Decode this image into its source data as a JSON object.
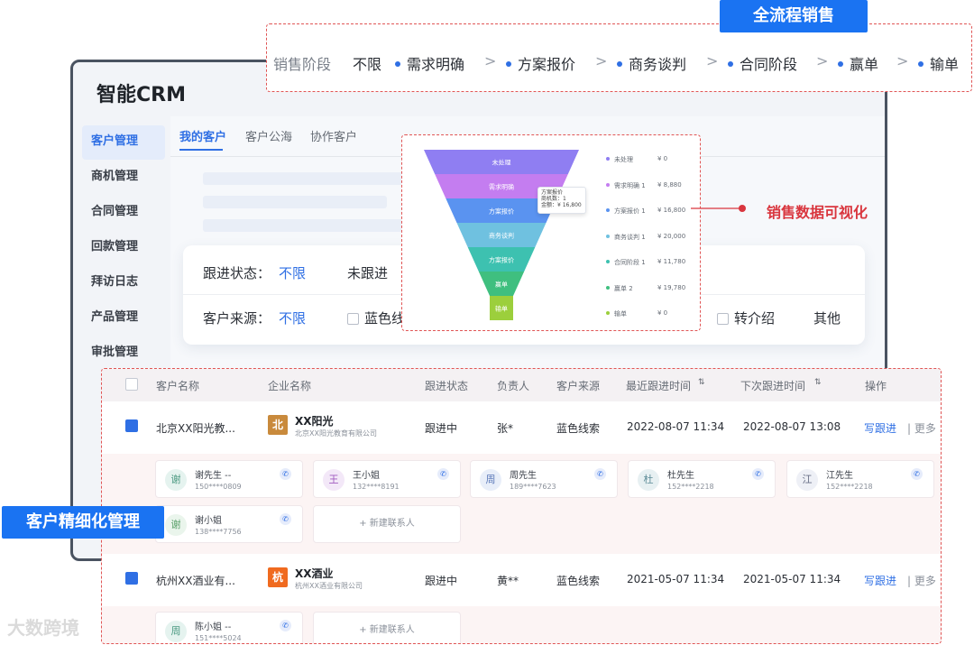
{
  "app": {
    "title": "智能CRM"
  },
  "sidebar": {
    "items": [
      {
        "label": "客户管理"
      },
      {
        "label": "商机管理"
      },
      {
        "label": "合同管理"
      },
      {
        "label": "回款管理"
      },
      {
        "label": "拜访日志"
      },
      {
        "label": "产品管理"
      },
      {
        "label": "审批管理"
      }
    ]
  },
  "tabs": [
    {
      "label": "我的客户"
    },
    {
      "label": "客户公海"
    },
    {
      "label": "协作客户"
    }
  ],
  "filters": {
    "status_label": "跟进状态：",
    "status_all": "不限",
    "status_option": "未跟进",
    "source_label": "客户来源：",
    "source_all": "不限",
    "source_option1": "蓝色线",
    "source_option2": "转介绍",
    "source_option3": "其他"
  },
  "pipeline": {
    "badge": "全流程销售",
    "label": "销售阶段",
    "all": "不限",
    "sep": ">",
    "stages": [
      "需求明确",
      "方案报价",
      "商务谈判",
      "合同阶段",
      "赢单",
      "输单"
    ]
  },
  "funnel": {
    "segments": [
      {
        "label": "未处理",
        "color": "#8f7ef2"
      },
      {
        "label": "需求明确",
        "color": "#c47df0"
      },
      {
        "label": "方案报价",
        "color": "#5a93f0"
      },
      {
        "label": "商务谈判",
        "color": "#6fc1e0"
      },
      {
        "label": "方案报价",
        "color": "#3dc1b0"
      },
      {
        "label": "赢单",
        "color": "#3fbf7f"
      },
      {
        "label": "输单",
        "color": "#9ccf3c"
      }
    ],
    "legend": [
      {
        "name": "未处理",
        "amount": "¥ 0",
        "color": "#8f7ef2"
      },
      {
        "name": "需求明确 1",
        "amount": "¥ 8,880",
        "color": "#c47df0"
      },
      {
        "name": "方案报价 1",
        "amount": "¥ 16,800",
        "color": "#5a93f0"
      },
      {
        "name": "商务谈判 1",
        "amount": "¥ 20,000",
        "color": "#6fc1e0"
      },
      {
        "name": "合同阶段 1",
        "amount": "¥ 11,780",
        "color": "#3dc1b0"
      },
      {
        "name": "赢单 2",
        "amount": "¥ 19,780",
        "color": "#3fbf7f"
      },
      {
        "name": "输单",
        "amount": "¥ 0",
        "color": "#9ccf3c"
      }
    ],
    "tooltip": {
      "line1": "方案报价",
      "line2": "商机数：1",
      "line3": "金额：¥ 16,800"
    }
  },
  "viz_label": "销售数据可视化",
  "table": {
    "headers": [
      "客户名称",
      "企业名称",
      "跟进状态",
      "负责人",
      "客户来源",
      "最近跟进时间",
      "下次跟进时间",
      "操作"
    ],
    "sort_icon": "⇅",
    "rows": [
      {
        "customer": "北京XX阳光教...",
        "logo_char": "北",
        "logo_color": "#c98a3c",
        "company": "XX阳光",
        "company_full": "北京XX阳光教育有限公司",
        "status": "跟进中",
        "owner": "张*",
        "source": "蓝色线索",
        "last_follow": "2022-08-07 11:34",
        "next_follow": "2022-08-07 13:08",
        "action": "写跟进",
        "more": "更多"
      },
      {
        "customer": "杭州XX酒业有...",
        "logo_char": "杭",
        "logo_color": "#f06a1f",
        "company": "XX酒业",
        "company_full": "杭州XX酒业有限公司",
        "status": "跟进中",
        "owner": "黄**",
        "source": "蓝色线索",
        "last_follow": "2021-05-07 11:34",
        "next_follow": "2021-05-07 11:34",
        "action": "写跟进",
        "more": "更多"
      }
    ],
    "contacts1": [
      {
        "avatar": "谢",
        "name": "谢先生 --",
        "phone": "150****0809"
      },
      {
        "avatar": "王",
        "name": "王小姐",
        "phone": "132****8191"
      },
      {
        "avatar": "周",
        "name": "周先生",
        "phone": "189****7623"
      },
      {
        "avatar": "杜",
        "name": "杜先生",
        "phone": "152****2218"
      },
      {
        "avatar": "江",
        "name": "江先生",
        "phone": "152****2218"
      },
      {
        "avatar": "谢",
        "name": "谢小姐",
        "phone": "138****7756"
      }
    ],
    "contacts2": [
      {
        "avatar": "周",
        "name": "陈小姐 --",
        "phone": "151****5024"
      }
    ],
    "add_contact": "+ 新建联系人"
  },
  "customer_badge": "客户精细化管理",
  "watermark": "大数跨境"
}
